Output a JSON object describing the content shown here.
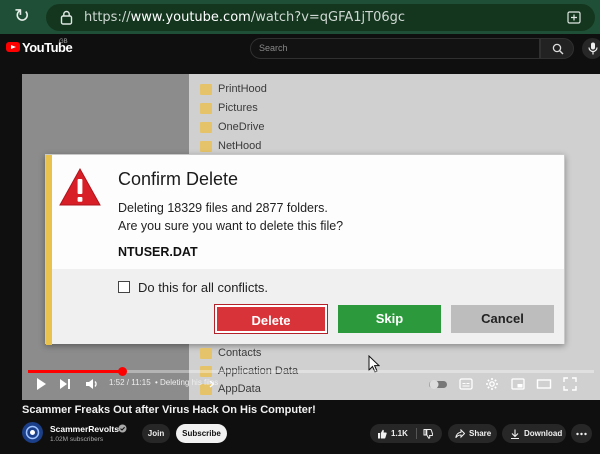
{
  "browser": {
    "url_prefix": "https://",
    "url_host": "www.youtube.com",
    "url_path": "/watch?v=qGFA1jT06gc",
    "reload_icon": "reload-icon",
    "lock_icon": "lock-icon"
  },
  "header": {
    "logo_text": "YouTube",
    "country_code": "GB",
    "search_placeholder": "Search"
  },
  "video": {
    "folders_top": [
      "PrintHood",
      "Pictures",
      "OneDrive",
      "NetHood"
    ],
    "folders_bottom": [
      "Contacts",
      "Application Data",
      "AppData"
    ],
    "dialog": {
      "title": "Confirm Delete",
      "line1": "Deleting 18329 files and 2877 folders.",
      "line2": "Are you sure you want to delete this file?",
      "filename": "NTUSER.DAT",
      "checkbox_label": "Do this for all conflicts.",
      "delete_label": "Delete",
      "skip_label": "Skip",
      "cancel_label": "Cancel",
      "colors": {
        "delete": "#d9333a",
        "skip": "#2c9a3c",
        "cancel": "#bdbdbd",
        "stripe": "#e8c24c"
      }
    },
    "player": {
      "time": "1:52 / 11:15",
      "chapter": "• Deleting his files",
      "progress_fraction": 0.166
    }
  },
  "meta": {
    "title": "Scammer Freaks Out after Virus Hack On His Computer!",
    "channel_name": "ScammerRevolts",
    "subscribers": "1.02M subscribers",
    "join_label": "Join",
    "subscribe_label": "Subscribe",
    "like_count": "1.1K",
    "share_label": "Share",
    "download_label": "Download"
  }
}
